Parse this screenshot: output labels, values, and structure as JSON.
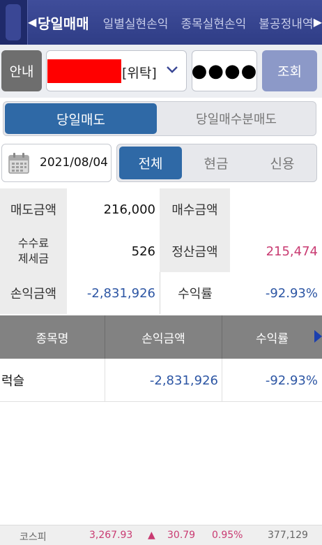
{
  "topbar": {
    "tabs": [
      "당일매매",
      "일별실현손익",
      "종목실현손익",
      "불공정내역"
    ],
    "left_arrow": "◀",
    "right_arrow": "▶"
  },
  "account": {
    "guide_label": "안내",
    "account_type": "[위탁]",
    "password_mask": "●●●●",
    "query_label": "조회"
  },
  "segment": {
    "active": "당일매도",
    "inactive": "당일매수분매도"
  },
  "filter": {
    "date": "2021/08/04",
    "options": [
      "전체",
      "현금",
      "신용"
    ],
    "selected": "전체"
  },
  "summary": {
    "sell_amount_label": "매도금액",
    "sell_amount": "216,000",
    "buy_amount_label": "매수금액",
    "buy_amount": "",
    "fee_tax_label_1": "수수료",
    "fee_tax_label_2": "제세금",
    "fee_tax": "526",
    "settle_label": "정산금액",
    "settle": "215,474",
    "pnl_label": "손익금액",
    "pnl": "-2,831,926",
    "return_label": "수익률",
    "return": "-92.93%"
  },
  "table": {
    "headers": [
      "종목명",
      "손익금액",
      "수익률"
    ],
    "rows": [
      {
        "name": "럭슬",
        "pnl": "-2,831,926",
        "return": "-92.93%"
      }
    ]
  },
  "ticker": {
    "index_name": "코스피",
    "value": "3,267.93",
    "arrow": "▲",
    "change": "30.79",
    "change_pct": "0.95%",
    "volume": "377,129"
  },
  "colors": {
    "accent_blue": "#2f69a6",
    "negative_blue": "#2d56a4",
    "positive_pink": "#c93b72",
    "redaction": "#ff0000"
  }
}
